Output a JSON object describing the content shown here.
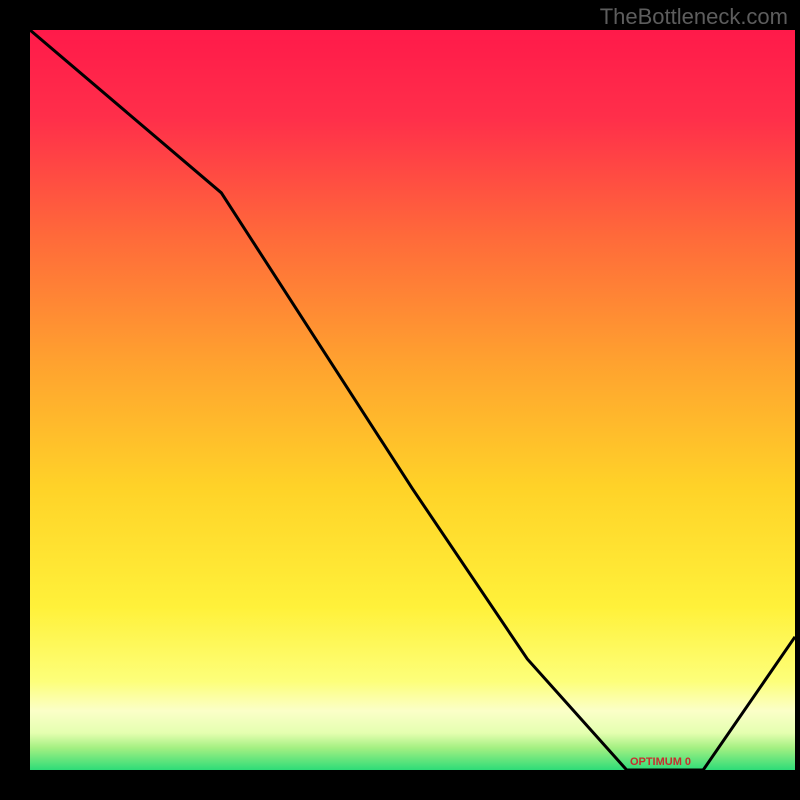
{
  "watermark": "TheBottleneck.com",
  "chart_data": {
    "type": "line",
    "title": "",
    "xlabel": "",
    "ylabel": "",
    "x": [
      0,
      0.25,
      0.5,
      0.65,
      0.78,
      0.83,
      0.88,
      1.0
    ],
    "values": [
      100,
      78,
      38,
      15,
      0,
      0,
      0,
      18
    ],
    "ylim": [
      0,
      100
    ],
    "xlim": [
      0,
      1
    ],
    "optimum_x_range": [
      0.78,
      0.88
    ],
    "optimum_label": "OPTIMUM 0",
    "colors": {
      "curve": "#000000",
      "optimum_text": "#c72e2e",
      "gradient_top": "#ff1a4a",
      "gradient_bottom": "#2edc78"
    }
  }
}
